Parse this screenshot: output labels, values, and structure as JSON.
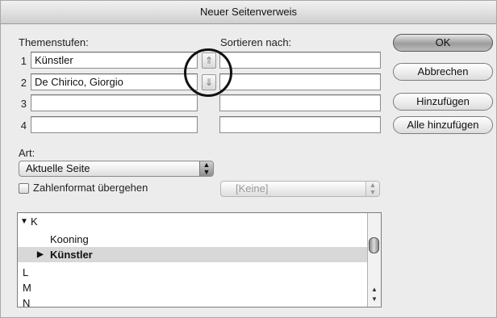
{
  "window": {
    "title": "Neuer Seitenverweis"
  },
  "levels": {
    "heading": "Themenstufen:",
    "rows": [
      {
        "num": "1",
        "value": "Künstler"
      },
      {
        "num": "2",
        "value": "De Chirico, Giorgio"
      },
      {
        "num": "3",
        "value": ""
      },
      {
        "num": "4",
        "value": ""
      }
    ]
  },
  "sort": {
    "heading": "Sortieren nach:",
    "up_icon": "up-arrow-icon",
    "down_icon": "down-arrow-icon"
  },
  "buttons": {
    "ok": "OK",
    "cancel": "Abbrechen",
    "add": "Hinzufügen",
    "add_all": "Alle hinzufügen"
  },
  "type": {
    "heading": "Art:",
    "selected": "Aktuelle Seite",
    "override_label": "Zahlenformat übergehen",
    "override_checked": false,
    "format_selected": "[Keine]"
  },
  "list": {
    "items": [
      {
        "label": "K",
        "expanded": true,
        "indent": 0
      },
      {
        "label": "Kooning",
        "indent": 1
      },
      {
        "label": "Künstler",
        "indent": 1,
        "selected": true,
        "collapsed": true
      },
      {
        "label": "L",
        "indent": 0
      },
      {
        "label": "M",
        "indent": 0
      },
      {
        "label": "N",
        "indent": 0
      }
    ]
  },
  "colors": {
    "default_button": "#9c9c9c",
    "selection": "#d8d8d8",
    "annotation_circle": "#111111"
  }
}
